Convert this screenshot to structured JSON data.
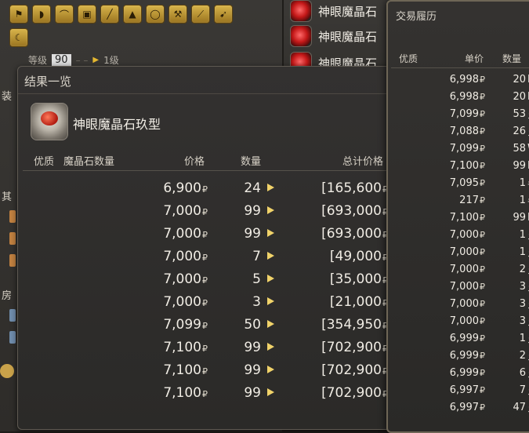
{
  "background": {
    "category_icons_row1": [
      "banner-icon",
      "pauldron-icon",
      "hat-icon",
      "armor-icon",
      "boots-icon",
      "pyramid-icon",
      "ring-icon",
      "axe-icon",
      "sword-icon",
      "knife-icon"
    ],
    "category_icons_row2": [
      "scythe-icon"
    ],
    "level_label": "等级",
    "level_value": "90",
    "level_target": "1级",
    "side_labels": [
      "装",
      "其",
      "房"
    ],
    "mid_items": [
      "神眼魔晶石",
      "神眼魔晶石",
      "神眼魔晶石"
    ]
  },
  "results": {
    "title": "结果一览",
    "item_name": "神眼魔晶石玖型",
    "headers": {
      "quality": "优质",
      "materia": "魔晶石数量",
      "price": "价格",
      "qty": "数量",
      "total": "总计价格"
    },
    "currency": "₽",
    "rows": [
      {
        "price": "6,900",
        "qty": "24",
        "total": "[165,600"
      },
      {
        "price": "7,000",
        "qty": "99",
        "total": "[693,000"
      },
      {
        "price": "7,000",
        "qty": "99",
        "total": "[693,000"
      },
      {
        "price": "7,000",
        "qty": "7",
        "total": "[49,000"
      },
      {
        "price": "7,000",
        "qty": "5",
        "total": "[35,000"
      },
      {
        "price": "7,000",
        "qty": "3",
        "total": "[21,000"
      },
      {
        "price": "7,099",
        "qty": "50",
        "total": "[354,950"
      },
      {
        "price": "7,100",
        "qty": "99",
        "total": "[702,900"
      },
      {
        "price": "7,100",
        "qty": "99",
        "total": "[702,900"
      },
      {
        "price": "7,100",
        "qty": "99",
        "total": "[702,900"
      }
    ]
  },
  "history": {
    "title": "交易履历",
    "headers": {
      "quality": "优质",
      "unit_price": "单价",
      "qty": "数量"
    },
    "currency": "₽",
    "rows": [
      {
        "price": "6,998",
        "qty": "20",
        "buyer": "E"
      },
      {
        "price": "6,998",
        "qty": "20",
        "buyer": "E"
      },
      {
        "price": "7,099",
        "qty": "53",
        "buyer": "ネ"
      },
      {
        "price": "7,088",
        "qty": "26",
        "buyer": "ネ"
      },
      {
        "price": "7,099",
        "qty": "58",
        "buyer": "W"
      },
      {
        "price": "7,100",
        "qty": "99",
        "buyer": "E"
      },
      {
        "price": "7,095",
        "qty": "1",
        "buyer": "월"
      },
      {
        "price": "217",
        "qty": "1",
        "buyer": "월"
      },
      {
        "price": "7,100",
        "qty": "99",
        "buyer": "E"
      },
      {
        "price": "7,000",
        "qty": "1",
        "buyer": "ネ"
      },
      {
        "price": "7,000",
        "qty": "1",
        "buyer": "ネ"
      },
      {
        "price": "7,000",
        "qty": "2",
        "buyer": "ネ"
      },
      {
        "price": "7,000",
        "qty": "3",
        "buyer": "ネ"
      },
      {
        "price": "7,000",
        "qty": "3",
        "buyer": "ネ"
      },
      {
        "price": "7,000",
        "qty": "3",
        "buyer": "ネ"
      },
      {
        "price": "6,999",
        "qty": "1",
        "buyer": "ネ"
      },
      {
        "price": "6,999",
        "qty": "2",
        "buyer": "ネ"
      },
      {
        "price": "6,999",
        "qty": "6",
        "buyer": "ネ"
      },
      {
        "price": "6,997",
        "qty": "7",
        "buyer": "ネ"
      },
      {
        "price": "6,997",
        "qty": "47",
        "buyer": "ネ"
      }
    ]
  }
}
